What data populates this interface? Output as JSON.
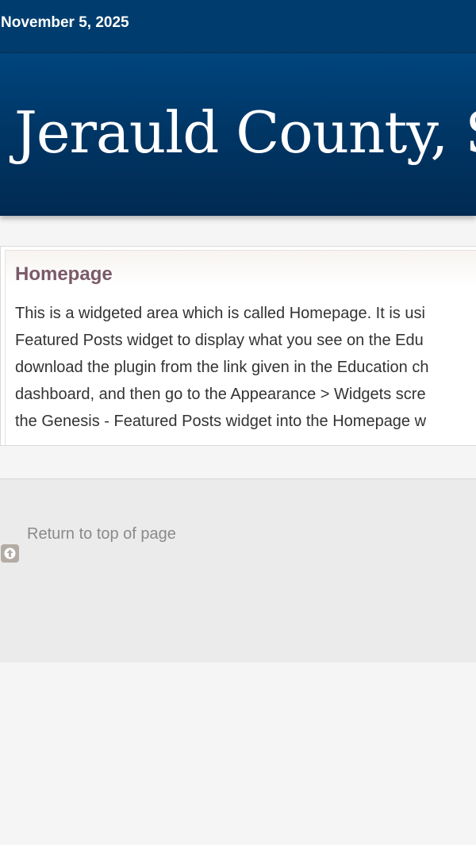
{
  "topbar": {
    "date": "November 5, 2025"
  },
  "header": {
    "site_title": "Jerauld County, S"
  },
  "widget": {
    "title": "Homepage",
    "lines": [
      "This is a widgeted area which is called Homepage. It is usi",
      "Featured Posts widget to display what you see on the Edu",
      "download the plugin from the link given in the Education ch",
      "dashboard, and then go to the Appearance > Widgets scre",
      "the Genesis - Featured Posts widget into the Homepage w"
    ]
  },
  "footer": {
    "return_to_top_label": "Return to top of page",
    "return_to_top_icon": "arrow-up-icon"
  },
  "colors": {
    "topbar": "#003d6e",
    "header_dark": "#002a52",
    "widget_title": "#7a5a68",
    "footer_bg": "#ebebeb",
    "page_bg": "#f5f5f5"
  }
}
